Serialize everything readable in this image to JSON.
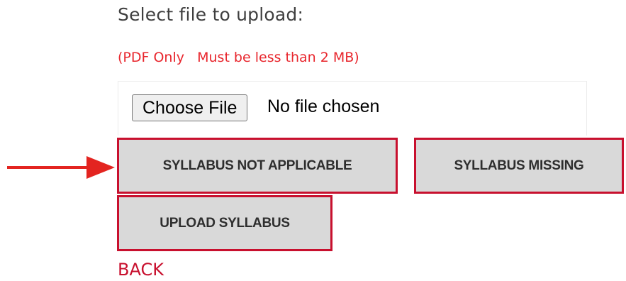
{
  "upload": {
    "heading": "Select file to upload:",
    "note": "(PDF Only   Must be less than 2 MB)",
    "file_input": {
      "button_label": "Choose File",
      "status": "No file chosen"
    }
  },
  "actions": {
    "not_applicable_label": "SYLLABUS NOT APPLICABLE",
    "missing_label": "SYLLABUS MISSING",
    "upload_label": "UPLOAD SYLLABUS"
  },
  "nav": {
    "back_label": "BACK"
  },
  "annotation": {
    "arrow_color": "#e32420",
    "arrow_points_to": "syllabus-not-applicable-button"
  },
  "colors": {
    "accent": "#c8102e",
    "note": "#e8262d",
    "button_bg": "#d9d9d9"
  }
}
